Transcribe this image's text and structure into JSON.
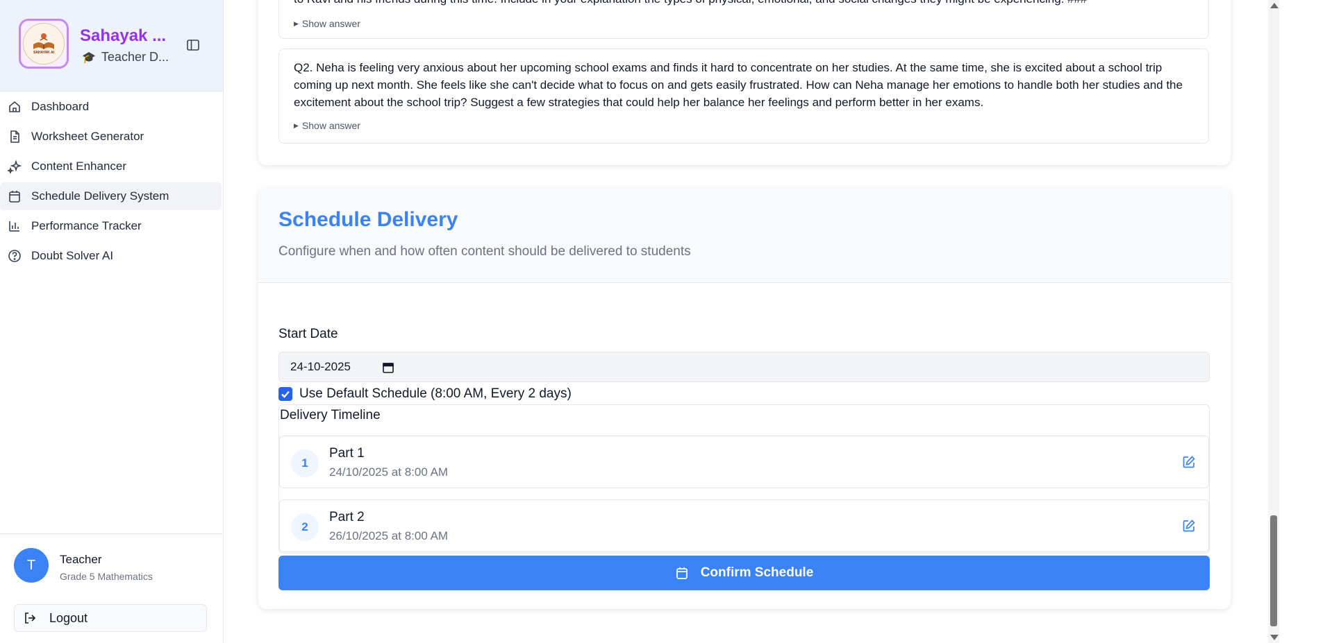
{
  "sidebar": {
    "brand": "Sahayak ...",
    "brand_sub": "Teacher D...",
    "logo_text": "SAHAYAK AI",
    "items": [
      {
        "label": "Dashboard",
        "icon": "home-icon"
      },
      {
        "label": "Worksheet Generator",
        "icon": "file-text-icon"
      },
      {
        "label": "Content Enhancer",
        "icon": "sparkles-icon"
      },
      {
        "label": "Schedule Delivery System",
        "icon": "calendar-icon",
        "active": true
      },
      {
        "label": "Performance Tracker",
        "icon": "bar-chart-icon"
      },
      {
        "label": "Doubt Solver AI",
        "icon": "help-circle-icon"
      }
    ],
    "user": {
      "initial": "T",
      "name": "Teacher",
      "subtitle": "Grade 5 Mathematics"
    },
    "logout_label": "Logout"
  },
  "questions": [
    {
      "text": "to Ravi and his friends during this time. Include in your explanation the types of physical, emotional, and social changes they might be experiencing. ###",
      "show_answer": "Show answer"
    },
    {
      "text": "Q2. Neha is feeling very anxious about her upcoming school exams and finds it hard to concentrate on her studies. At the same time, she is excited about a school trip coming up next month. She feels like she can't decide what to focus on and gets easily frustrated. How can Neha manage her emotions to handle both her studies and the excitement about the school trip? Suggest a few strategies that could help her balance her feelings and perform better in her exams.",
      "show_answer": "Show answer"
    }
  ],
  "schedule": {
    "title": "Schedule Delivery",
    "description": "Configure when and how often content should be delivered to students",
    "start_date_label": "Start Date",
    "start_date_value": "24-10-2025",
    "default_schedule_label": "Use Default Schedule (8:00 AM, Every 2 days)",
    "default_schedule_checked": true,
    "timeline_title": "Delivery Timeline",
    "parts": [
      {
        "num": "1",
        "name": "Part 1",
        "when": "24/10/2025 at 8:00 AM"
      },
      {
        "num": "2",
        "name": "Part 2",
        "when": "26/10/2025 at 8:00 AM"
      }
    ],
    "confirm_label": "Confirm Schedule"
  },
  "colors": {
    "accent": "#3b82f6",
    "brand": "#9333ea",
    "checkbox": "#2563eb"
  }
}
